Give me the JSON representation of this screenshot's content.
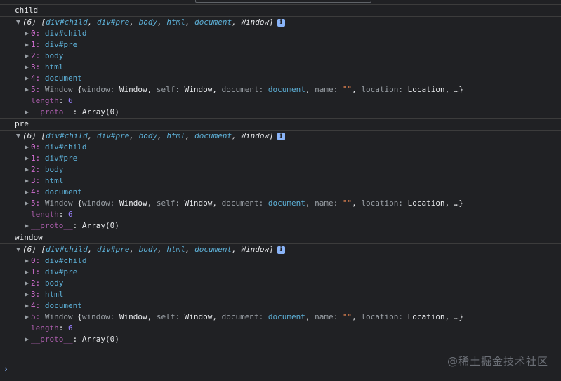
{
  "console": {
    "messages": [
      {
        "label": "child",
        "array": {
          "summary_count": "(6)",
          "summary_items": [
            "div#child",
            "div#pre",
            "body",
            "html",
            "document",
            "Window"
          ],
          "entries": [
            {
              "index": "0:",
              "value": "div#child"
            },
            {
              "index": "1:",
              "value": "div#pre"
            },
            {
              "index": "2:",
              "value": "body"
            },
            {
              "index": "3:",
              "value": "html"
            },
            {
              "index": "4:",
              "value": "document"
            }
          ],
          "window_entry": {
            "index": "5:",
            "type": "Window",
            "preview": [
              {
                "key": "window",
                "value": "Window"
              },
              {
                "key": "self",
                "value": "Window"
              },
              {
                "key": "document",
                "value": "document"
              },
              {
                "key": "name",
                "value": "\"\""
              },
              {
                "key": "location",
                "value": "Location"
              }
            ],
            "ellipsis": "…}"
          },
          "length_key": "length",
          "length_value": "6",
          "proto_key": "__proto__",
          "proto_value": "Array(0)"
        }
      },
      {
        "label": "pre",
        "array": {
          "summary_count": "(6)",
          "summary_items": [
            "div#child",
            "div#pre",
            "body",
            "html",
            "document",
            "Window"
          ],
          "entries": [
            {
              "index": "0:",
              "value": "div#child"
            },
            {
              "index": "1:",
              "value": "div#pre"
            },
            {
              "index": "2:",
              "value": "body"
            },
            {
              "index": "3:",
              "value": "html"
            },
            {
              "index": "4:",
              "value": "document"
            }
          ],
          "window_entry": {
            "index": "5:",
            "type": "Window",
            "preview": [
              {
                "key": "window",
                "value": "Window"
              },
              {
                "key": "self",
                "value": "Window"
              },
              {
                "key": "document",
                "value": "document"
              },
              {
                "key": "name",
                "value": "\"\""
              },
              {
                "key": "location",
                "value": "Location"
              }
            ],
            "ellipsis": "…}"
          },
          "length_key": "length",
          "length_value": "6",
          "proto_key": "__proto__",
          "proto_value": "Array(0)"
        }
      },
      {
        "label": "window",
        "array": {
          "summary_count": "(6)",
          "summary_items": [
            "div#child",
            "div#pre",
            "body",
            "html",
            "document",
            "Window"
          ],
          "entries": [
            {
              "index": "0:",
              "value": "div#child"
            },
            {
              "index": "1:",
              "value": "div#pre"
            },
            {
              "index": "2:",
              "value": "body"
            },
            {
              "index": "3:",
              "value": "html"
            },
            {
              "index": "4:",
              "value": "document"
            }
          ],
          "window_entry": {
            "index": "5:",
            "type": "Window",
            "preview": [
              {
                "key": "window",
                "value": "Window"
              },
              {
                "key": "self",
                "value": "Window"
              },
              {
                "key": "document",
                "value": "document"
              },
              {
                "key": "name",
                "value": "\"\""
              },
              {
                "key": "location",
                "value": "Location"
              }
            ],
            "ellipsis": "…}"
          },
          "length_key": "length",
          "length_value": "6",
          "proto_key": "__proto__",
          "proto_value": "Array(0)"
        }
      }
    ],
    "prompt_glyph": "›"
  },
  "watermark": "@稀土掘金技术社区",
  "colors": {
    "background": "#202124",
    "dom_node": "#5db0d7",
    "index_key": "#d670d6",
    "number": "#9980ff",
    "string": "#f28b54",
    "info_icon": "#8ab4f8"
  },
  "icons": {
    "expand_open": "triangle-down-icon",
    "expand_closed": "triangle-right-icon",
    "info": "info-icon",
    "prompt": "chevron-right-icon"
  }
}
